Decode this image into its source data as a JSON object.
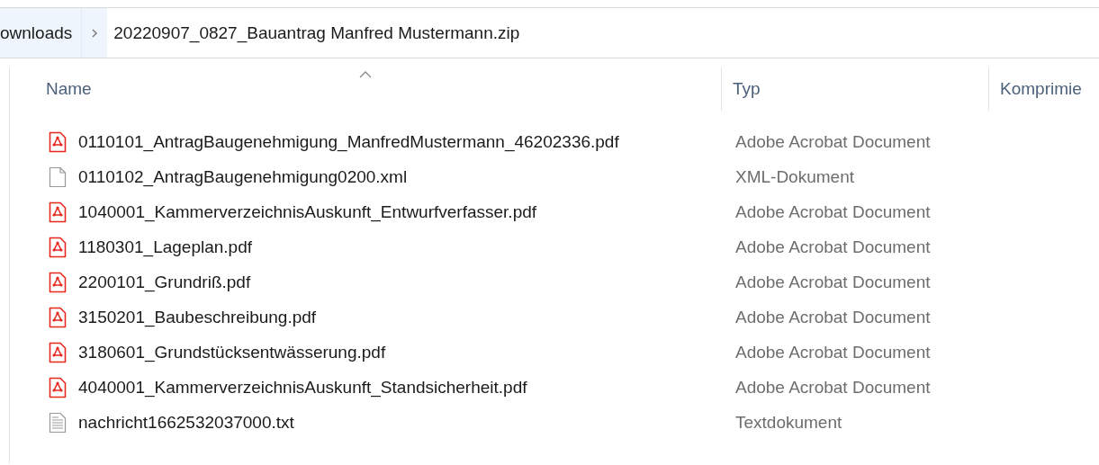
{
  "breadcrumb": [
    {
      "label": "ownloads",
      "selected": false
    },
    {
      "label": "20220907_0827_Bauantrag Manfred Mustermann.zip",
      "selected": true
    }
  ],
  "columns": [
    {
      "label": "Name",
      "sorted": true
    },
    {
      "label": "Typ",
      "sorted": false
    },
    {
      "label": "Komprimie",
      "sorted": false
    }
  ],
  "files": [
    {
      "kind": "pdf",
      "name": "0110101_AntragBaugenehmigung_ManfredMustermann_46202336.pdf",
      "type": "Adobe Acrobat Document"
    },
    {
      "kind": "xml",
      "name": "0110102_AntragBaugenehmigung0200.xml",
      "type": "XML-Dokument"
    },
    {
      "kind": "pdf",
      "name": "1040001_KammerverzeichnisAuskunft_Entwurfverfasser.pdf",
      "type": "Adobe Acrobat Document"
    },
    {
      "kind": "pdf",
      "name": "1180301_Lageplan.pdf",
      "type": "Adobe Acrobat Document"
    },
    {
      "kind": "pdf",
      "name": "2200101_Grundriß.pdf",
      "type": "Adobe Acrobat Document"
    },
    {
      "kind": "pdf",
      "name": "3150201_Baubeschreibung.pdf",
      "type": "Adobe Acrobat Document"
    },
    {
      "kind": "pdf",
      "name": "3180601_Grundstücksentwässerung.pdf",
      "type": "Adobe Acrobat Document"
    },
    {
      "kind": "pdf",
      "name": "4040001_KammerverzeichnisAuskunft_Standsicherheit.pdf",
      "type": "Adobe Acrobat Document"
    },
    {
      "kind": "txt",
      "name": "nachricht1662532037000.txt",
      "type": "Textdokument"
    }
  ]
}
